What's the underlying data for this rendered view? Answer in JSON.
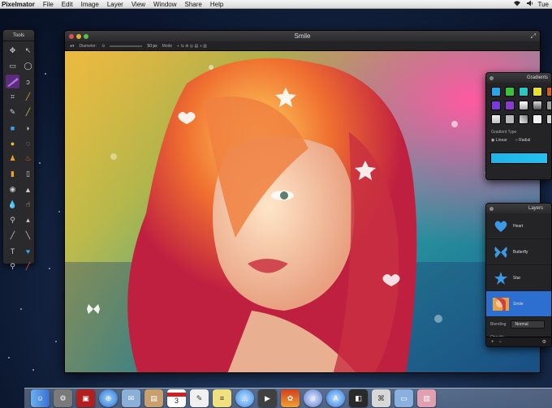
{
  "menubar": {
    "app_name": "Pixelmator",
    "items": [
      "File",
      "Edit",
      "Image",
      "Layer",
      "View",
      "Window",
      "Share",
      "Help"
    ],
    "clock": "Tue"
  },
  "tools_palette": {
    "title": "Tools",
    "tools": [
      "move-tool",
      "selection-tool",
      "rect-select-tool",
      "ellipse-select-tool",
      "lasso-tool",
      "magic-wand-tool",
      "crop-tool",
      "eyedropper-tool",
      "brush-tool",
      "pencil-tool",
      "eraser-tool",
      "paint-bucket-tool",
      "gradient-tool",
      "type-tool",
      "shape-tool",
      "clone-tool",
      "dodge-tool",
      "burn-tool",
      "blur-tool",
      "sharpen-tool",
      "red-eye-tool",
      "sponge-tool",
      "smudge-tool",
      "pen-tool",
      "zoom-tool",
      "hand-tool",
      "custom-shape-tool",
      "color-well"
    ]
  },
  "window": {
    "title": "Smile",
    "options": {
      "diameter_label": "Diameter:",
      "diameter_value": "50 px",
      "mode_label": "Mode"
    }
  },
  "gradients_panel": {
    "title": "Gradients",
    "swatch_colors": [
      "#2ca3e8",
      "#3ac33a",
      "#2cc6c0",
      "#e8e030",
      "#d06020",
      "#7a3ad8",
      "#8a3ad0",
      "#f4f4f4",
      "#ffffff",
      "#9a9a9a",
      "#e8e8e8",
      "#b8b8b8",
      "#c8c8c8",
      "#f0f0f0",
      "#d0d0d0"
    ],
    "type_label": "Gradient Type",
    "options": [
      "Linear",
      "Radial"
    ],
    "accent": "#1fb4e6"
  },
  "layers_panel": {
    "title": "Layers",
    "layers": [
      {
        "name": "Heart",
        "icon": "heart-shape"
      },
      {
        "name": "Butterfly",
        "icon": "butterfly-shape"
      },
      {
        "name": "Star",
        "icon": "star-shape"
      },
      {
        "name": "Smile",
        "icon": "photo-thumbnail"
      }
    ],
    "selected_layer": "Smile",
    "blending_label": "Blending",
    "blending_value": "Normal",
    "opacity_label": "Opacity"
  },
  "dock": {
    "apps": [
      "finder",
      "system-preferences",
      "photo-booth",
      "safari",
      "mail",
      "preview",
      "calendar",
      "textedit",
      "notes",
      "messages",
      "facetime",
      "photos",
      "itunes",
      "app-store",
      "pixelmator",
      "gimp",
      "documents",
      "trash"
    ],
    "calendar_day": "3"
  }
}
